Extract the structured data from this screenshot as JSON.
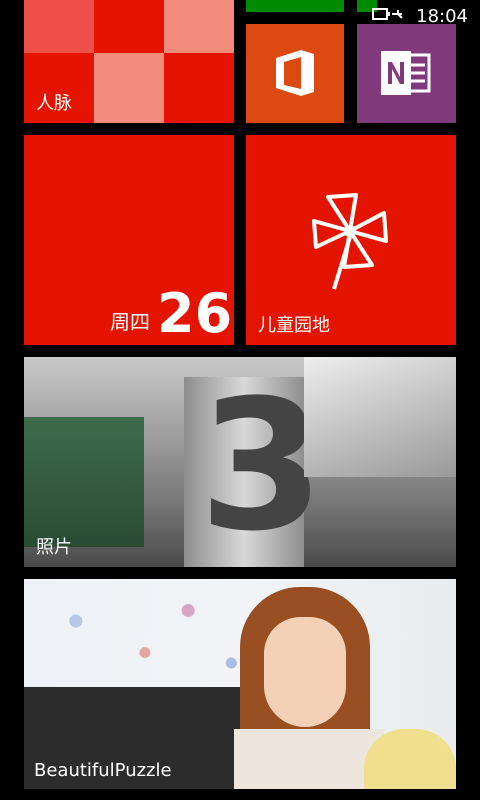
{
  "status_bar": {
    "time": "18:04",
    "battery_icon": "battery-charging-icon"
  },
  "tiles": {
    "people": {
      "label": "人脉",
      "color": "#e51400"
    },
    "office": {
      "icon": "office-icon",
      "color": "#dc4a11"
    },
    "onenote": {
      "icon": "onenote-icon",
      "color": "#80397b"
    },
    "calendar": {
      "weekday": "周四",
      "date": "26",
      "color": "#e51400"
    },
    "kids_corner": {
      "label": "儿童园地",
      "icon": "pinwheel-icon",
      "color": "#e51400"
    },
    "photos": {
      "label": "照片"
    },
    "beautiful_puzzle": {
      "label": "BeautifulPuzzle"
    }
  },
  "top_partial_tiles": {
    "left_color": "#008a00",
    "right_color": "#008a00"
  }
}
